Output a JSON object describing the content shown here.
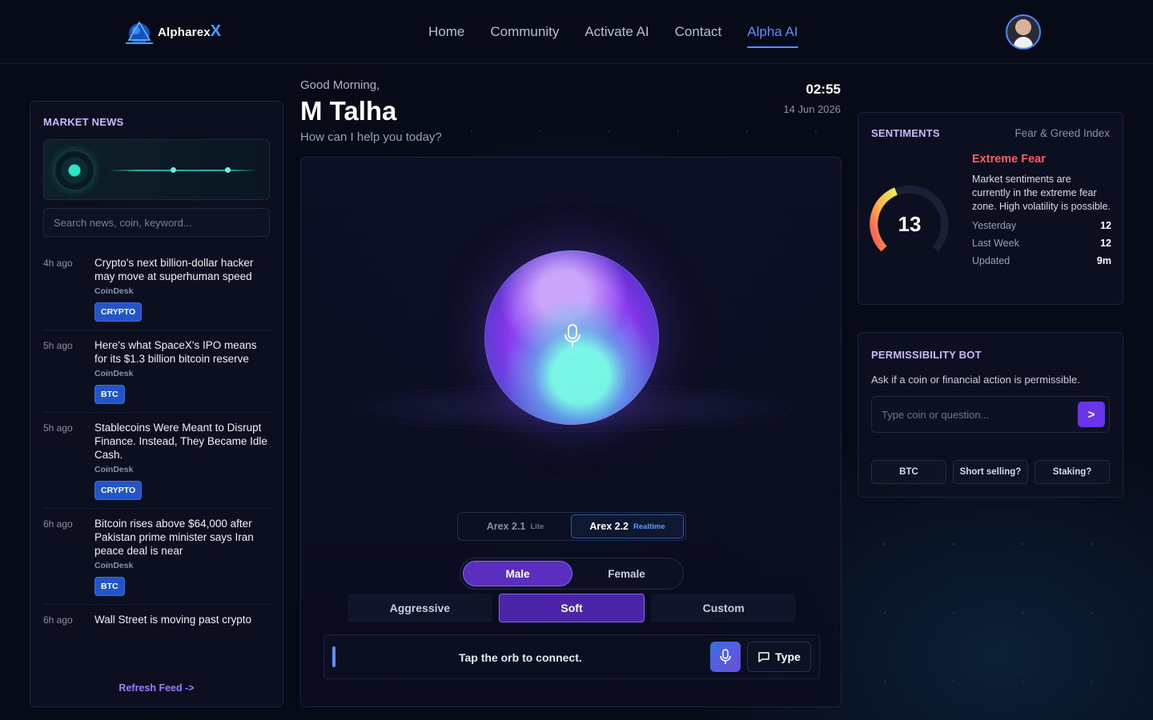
{
  "nav": {
    "logo_text": "Alpharex",
    "logo_x": "X",
    "links": [
      {
        "label": "Home"
      },
      {
        "label": "Community"
      },
      {
        "label": "Activate AI"
      },
      {
        "label": "Contact"
      },
      {
        "label": "Alpha AI",
        "active": true
      }
    ]
  },
  "news": {
    "title": "MARKET NEWS",
    "search_placeholder": "Search news, coin, keyword...",
    "items": [
      {
        "time": "4h ago",
        "title": "Crypto's next billion-dollar hacker may move at superhuman speed",
        "source": "CoinDesk",
        "tag": "CRYPTO"
      },
      {
        "time": "5h ago",
        "title": "Here's what SpaceX's IPO means for its $1.3 billion bitcoin reserve",
        "source": "CoinDesk",
        "tag": "BTC"
      },
      {
        "time": "5h ago",
        "title": "Stablecoins Were Meant to Disrupt Finance. Instead, They Became Idle Cash.",
        "source": "CoinDesk",
        "tag": "CRYPTO"
      },
      {
        "time": "6h ago",
        "title": "Bitcoin rises above $64,000 after Pakistan prime minister says Iran peace deal is near",
        "source": "CoinDesk",
        "tag": "BTC"
      },
      {
        "time": "6h ago",
        "title": "Wall Street is moving past crypto"
      }
    ],
    "refresh_label": "Refresh Feed  ->"
  },
  "greeting": {
    "salutation": "Good Morning,",
    "name": "M Talha",
    "prompt": "How can I help you today?",
    "time": "02:55",
    "date": "14 Jun 2026"
  },
  "assistant": {
    "models": [
      {
        "name": "Arex 2.1",
        "sub": "Lite",
        "active": false
      },
      {
        "name": "Arex 2.2",
        "sub": "Realtime",
        "active": true
      }
    ],
    "genders": [
      {
        "label": "Male",
        "active": true
      },
      {
        "label": "Female",
        "active": false
      }
    ],
    "tones": [
      {
        "label": "Aggressive",
        "active": false
      },
      {
        "label": "Soft",
        "active": true
      },
      {
        "label": "Custom",
        "active": false
      }
    ],
    "status_text": "Tap the orb to connect.",
    "type_label": "Type",
    "icons": {
      "orb": "microphone-icon",
      "mic": "microphone-icon",
      "type": "chat-bubble-icon"
    }
  },
  "sentiments": {
    "title": "SENTIMENTS",
    "index_name": "Fear & Greed Index",
    "value": 13,
    "label": "Extreme Fear",
    "description": "Market sentiments are currently in the extreme fear zone. High volatility is possible.",
    "rows": [
      {
        "label": "Yesterday",
        "value": "12"
      },
      {
        "label": "Last Week",
        "value": "12"
      },
      {
        "label": "Updated",
        "value": "9m"
      }
    ],
    "colors": {
      "label": "#ff5a6a"
    }
  },
  "permissibility": {
    "title": "PERMISSIBILITY BOT",
    "description": "Ask if a coin or financial action is permissible.",
    "input_placeholder": "Type coin or question...",
    "send_label": ">",
    "chips": [
      "BTC",
      "Short selling?",
      "Staking?"
    ]
  }
}
